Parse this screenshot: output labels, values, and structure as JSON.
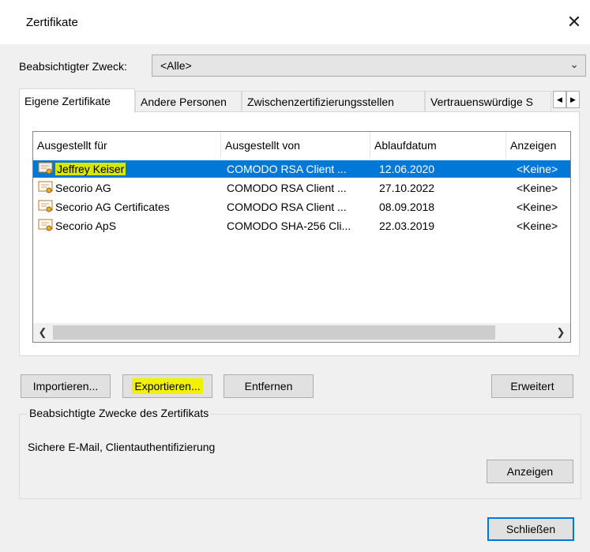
{
  "window": {
    "title": "Zertifikate",
    "close_glyph": "✕"
  },
  "purpose": {
    "label": "Beabsichtigter Zweck:",
    "value": "<Alle>"
  },
  "tabs": [
    {
      "label": "Eigene Zertifikate",
      "active": true
    },
    {
      "label": "Andere Personen",
      "active": false
    },
    {
      "label": "Zwischenzertifizierungsstellen",
      "active": false
    },
    {
      "label": "Vertrauenswürdige S",
      "active": false
    }
  ],
  "list": {
    "columns": [
      "Ausgestellt für",
      "Ausgestellt von",
      "Ablaufdatum",
      "Anzeigen"
    ],
    "rows": [
      {
        "issued_to": "Jeffrey Keiser",
        "issued_by": "COMODO RSA Client ...",
        "expires": "12.06.2020",
        "friendly": "<Keine>",
        "selected": true
      },
      {
        "issued_to": "Secorio AG",
        "issued_by": "COMODO RSA Client ...",
        "expires": "27.10.2022",
        "friendly": "<Keine>"
      },
      {
        "issued_to": "Secorio AG Certificates",
        "issued_by": "COMODO RSA Client ...",
        "expires": "08.09.2018",
        "friendly": "<Keine>"
      },
      {
        "issued_to": "Secorio ApS",
        "issued_by": "COMODO SHA-256 Cli...",
        "expires": "22.03.2019",
        "friendly": "<Keine>"
      }
    ]
  },
  "buttons": {
    "import": "Importieren...",
    "export": "Exportieren...",
    "remove": "Entfernen",
    "advanced": "Erweitert",
    "view": "Anzeigen",
    "close": "Schließen"
  },
  "purposes_group": {
    "title": "Beabsichtigte Zwecke des Zertifikats",
    "text": "Sichere E-Mail, Clientauthentifizierung"
  },
  "colors": {
    "selection": "#0078d7",
    "highlight": "#f2f200",
    "accent": "#0078d7"
  }
}
